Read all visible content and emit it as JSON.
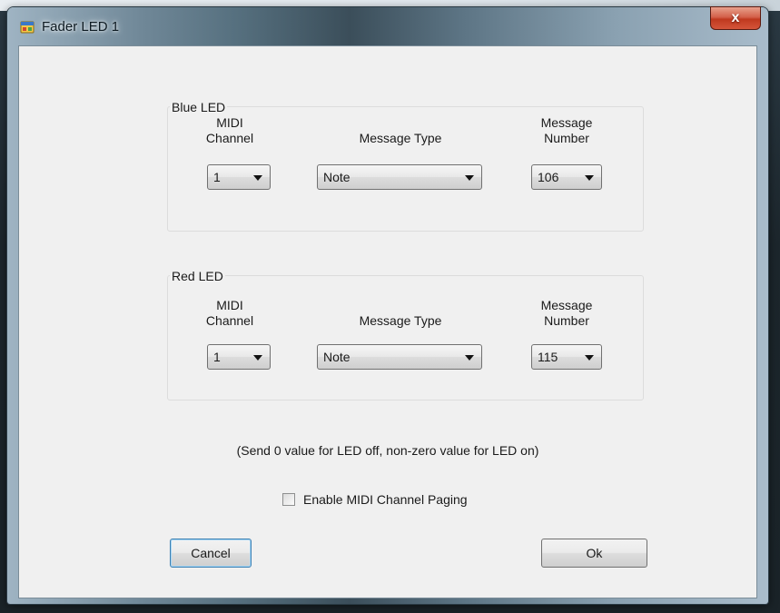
{
  "window": {
    "title": "Fader LED 1",
    "close_label": "x"
  },
  "groups": [
    {
      "label": "Blue LED",
      "midi_channel_label": [
        "MIDI",
        "Channel"
      ],
      "message_type_label": "Message Type",
      "message_number_label": [
        "Message",
        "Number"
      ],
      "midi_channel": "1",
      "message_type": "Note",
      "message_number": "106"
    },
    {
      "label": "Red LED",
      "midi_channel_label": [
        "MIDI",
        "Channel"
      ],
      "message_type_label": "Message Type",
      "message_number_label": [
        "Message",
        "Number"
      ],
      "midi_channel": "1",
      "message_type": "Note",
      "message_number": "115"
    }
  ],
  "note": "(Send 0 value for LED off, non-zero value for LED on)",
  "paging": {
    "label": "Enable MIDI Channel Paging",
    "checked": false
  },
  "buttons": {
    "cancel": "Cancel",
    "ok": "Ok"
  },
  "icons": {
    "app": "app-icon",
    "close": "close-icon",
    "dropdown": "chevron-down-icon"
  }
}
